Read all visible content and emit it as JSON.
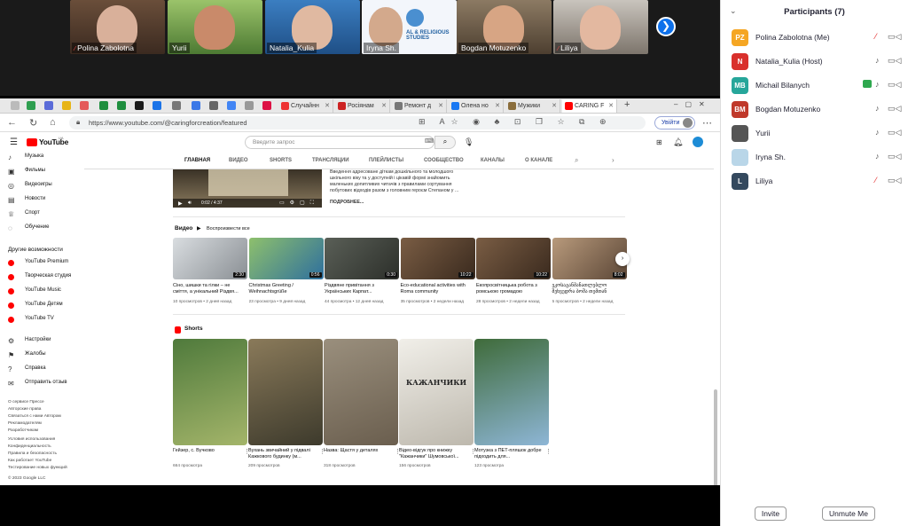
{
  "strip": {
    "tiles": [
      {
        "name": "Polina Zabolotna",
        "muted": true
      },
      {
        "name": "Yurii",
        "muted": false
      },
      {
        "name": "Natalia_Kulia",
        "muted": false
      },
      {
        "name": "Iryna Sh.",
        "muted": false
      },
      {
        "name": "Bogdan Motuzenko",
        "muted": false
      },
      {
        "name": "Liliya",
        "muted": true
      }
    ],
    "logo_text": "AL & RELIGIOUS STUDIES",
    "mute_icon": "⁄"
  },
  "panel": {
    "title": "Participants (7)",
    "chevron": "⌄",
    "participants": [
      {
        "initials": "PZ",
        "color": "#f5a623",
        "name": "Polina Zabolotna (Me)",
        "muted": true
      },
      {
        "initials": "N",
        "color": "#d9302c",
        "name": "Natalia_Kulia (Host)",
        "muted": false
      },
      {
        "initials": "MB",
        "color": "#26a69a",
        "name": "Michail Bilanych",
        "muted": false
      },
      {
        "initials": "BM",
        "color": "#c0392b",
        "name": "Bogdan Motuzenko",
        "muted": false
      },
      {
        "initials": "",
        "color": "#555555",
        "name": "Yurii",
        "muted": false
      },
      {
        "initials": "",
        "color": "#b9d6e8",
        "name": "Iryna Sh.",
        "muted": false
      },
      {
        "initials": "L",
        "color": "#34495e",
        "name": "Liliya",
        "muted": true
      }
    ],
    "invite": "Invite",
    "unmute": "Unmute Me"
  },
  "browser": {
    "tabs": [
      {
        "label": "Случайнн",
        "color": "#e33"
      },
      {
        "label": "Росіянам",
        "color": "#c22"
      },
      {
        "label": "Ремонт д",
        "color": "#777"
      },
      {
        "label": "Олена но",
        "color": "#1877f2"
      },
      {
        "label": "Мужики",
        "color": "#8a6d3b"
      },
      {
        "label": "CARING F",
        "color": "#f00"
      }
    ],
    "url": "https://www.youtube.com/@caringforcreation/featured",
    "signin": "Увійти",
    "new_tab": "+"
  },
  "yt": {
    "logo": "YouTube",
    "logo_sup": "UA",
    "search_placeholder": "Введите запрос",
    "nav_top": [
      {
        "icon": "♪",
        "label": "Музыка"
      },
      {
        "icon": "▣",
        "label": "Фильмы"
      },
      {
        "icon": "◎",
        "label": "Видеоигры"
      },
      {
        "icon": "▤",
        "label": "Новости"
      },
      {
        "icon": "♕",
        "label": "Спорт"
      },
      {
        "icon": "◌",
        "label": "Обучение"
      }
    ],
    "other_title": "Другие возможности",
    "nav_other": [
      "YouTube Premium",
      "Творческая студия",
      "YouTube Music",
      "YouTube Детям",
      "YouTube TV"
    ],
    "nav_settings": [
      {
        "icon": "⚙",
        "label": "Настройки"
      },
      {
        "icon": "⚑",
        "label": "Жалобы"
      },
      {
        "icon": "?",
        "label": "Справка"
      },
      {
        "icon": "✉",
        "label": "Отправить отзыв"
      }
    ],
    "footer1": "О сервисе  Прессе",
    "footer2": "Авторские права",
    "footer3": "Связаться с нами  Авторам",
    "footer4": "Рекламодателям",
    "footer5": "Разработчикам",
    "footer6": "Условия использования",
    "footer7": "Конфиденциальность",
    "footer8": "Правила и безопасность",
    "footer9": "Как работает YouTube",
    "footer10": "Тестирование новых функций",
    "footer11": "© 2023 Google LLC",
    "channel_tabs": [
      "ГЛАВНАЯ",
      "ВИДЕО",
      "SHORTS",
      "ТРАНСЛЯЦИИ",
      "ПЛЕЙЛИСТЫ",
      "СООБЩЕСТВО",
      "КАНАЛЫ",
      "О КАНАЛЕ"
    ],
    "featured_desc": "Введення адресоване діткам дошкільного та молодшого шкільного віку та у доступній і цікавій формі знайомить маленьких допитливих читачів з правилами сортування побутових відходів разом з головним героєм Степаном у ...",
    "featured_more": "ПОДРОБНЕЕ...",
    "player_time": "0:02 / 4:37",
    "videos_label": "Видео",
    "play_all": "Воспроизвести все",
    "videos": [
      {
        "title": "Сіно, шишки та гілки – не сміття, а унікальний Різдвя...",
        "meta": "10 просмотров • 2 дней назад",
        "dur": "2:30",
        "c1": "#d9dde0",
        "c2": "#8a8f94"
      },
      {
        "title": "Christmas Greeting / Weihnachtsgrüße",
        "meta": "23 просмотра • 9 дней назад",
        "dur": "0:56",
        "c1": "#8ec06c",
        "c2": "#2e6f9e"
      },
      {
        "title": "Різдвяне привітання з Українських Карпат...",
        "meta": "44 просмотра • 12 дней назад",
        "dur": "0:30",
        "c1": "#5a5f57",
        "c2": "#2c2f2a"
      },
      {
        "title": "Eco-educational activities with Roma community",
        "meta": "35 просмотров • 2 недели назад",
        "dur": "10:22",
        "c1": "#7a5d44",
        "c2": "#3a2a1e"
      },
      {
        "title": "Екопросвітницька робота з ромською громадою",
        "meta": "28 просмотров • 2 недели назад",
        "dur": "10:22",
        "c1": "#7a5d44",
        "c2": "#3a2a1e"
      },
      {
        "title": "ეკოსაგანმანათლებლო შეხვედრა ბოშა თემთან",
        "meta": "5 просмотров • 2 недели назад",
        "dur": "8:02",
        "c1": "#b89a7c",
        "c2": "#5b4636"
      }
    ],
    "shorts_label": "Shorts",
    "shorts": [
      {
        "title": "Гейзер, с. Вучково",
        "meta": "664 просмотра",
        "c1": "#4f7a3c",
        "c2": "#a4b56a"
      },
      {
        "title": "Вухань звичайний у підвалі Кажкового будинку (м...",
        "meta": "209 просмотров",
        "c1": "#8a7a5a",
        "c2": "#3d3a2c"
      },
      {
        "title": "Назва: Щастя у деталях",
        "meta": "318 просмотров",
        "c1": "#9a8f7d",
        "c2": "#6a5e4e"
      },
      {
        "title": "Відео-відгук про книжку \"Кажанчики\" Шумовської...",
        "meta": "156 просмотров",
        "c1": "#f1efe9",
        "c2": "#bdb8ad"
      },
      {
        "title": "Мотузка з ПЕТ-пляшок добре підходить для...",
        "meta": "123 просмотра",
        "c1": "#3f6b3a",
        "c2": "#8eb6d6"
      }
    ],
    "book_word": "КАЖАНЧИКИ"
  }
}
